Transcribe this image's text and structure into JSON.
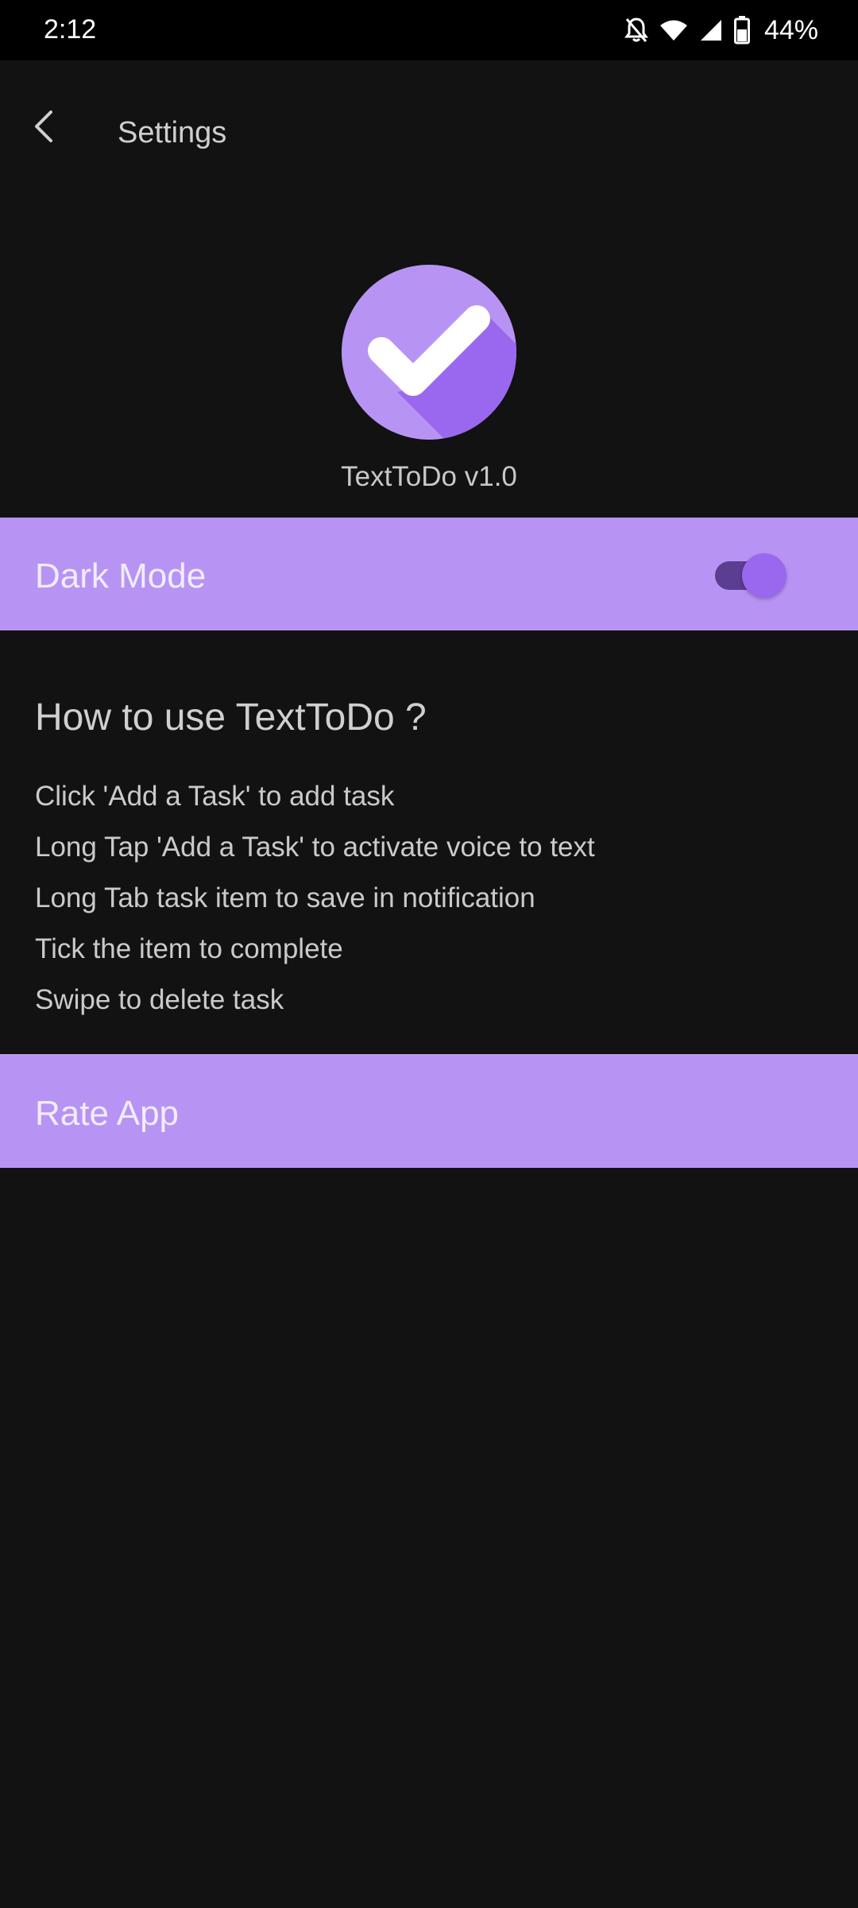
{
  "status_bar": {
    "time": "2:12",
    "battery": "44%",
    "icons": [
      "notifications-off-icon",
      "wifi-icon",
      "cell-signal-icon",
      "battery-icon"
    ]
  },
  "app_bar": {
    "back_icon": "chevron-left-icon",
    "title": "Settings"
  },
  "app_info": {
    "logo_icon": "checkmark-circle-icon",
    "version": "TextToDo v1.0"
  },
  "dark_mode": {
    "label": "Dark Mode",
    "enabled": true
  },
  "how_to": {
    "title": "How to use TextToDo ?",
    "items": [
      "Click 'Add a Task' to add task",
      "Long Tap 'Add a Task' to activate voice to text",
      "Long Tab task item to save in notification",
      "Tick the item to complete",
      "Swipe to delete task"
    ]
  },
  "rate_app": {
    "label": "Rate App"
  },
  "colors": {
    "background": "#121212",
    "accent": "#b794f4",
    "toggle_thumb": "#9a68ee",
    "toggle_track": "#5b3d91"
  }
}
